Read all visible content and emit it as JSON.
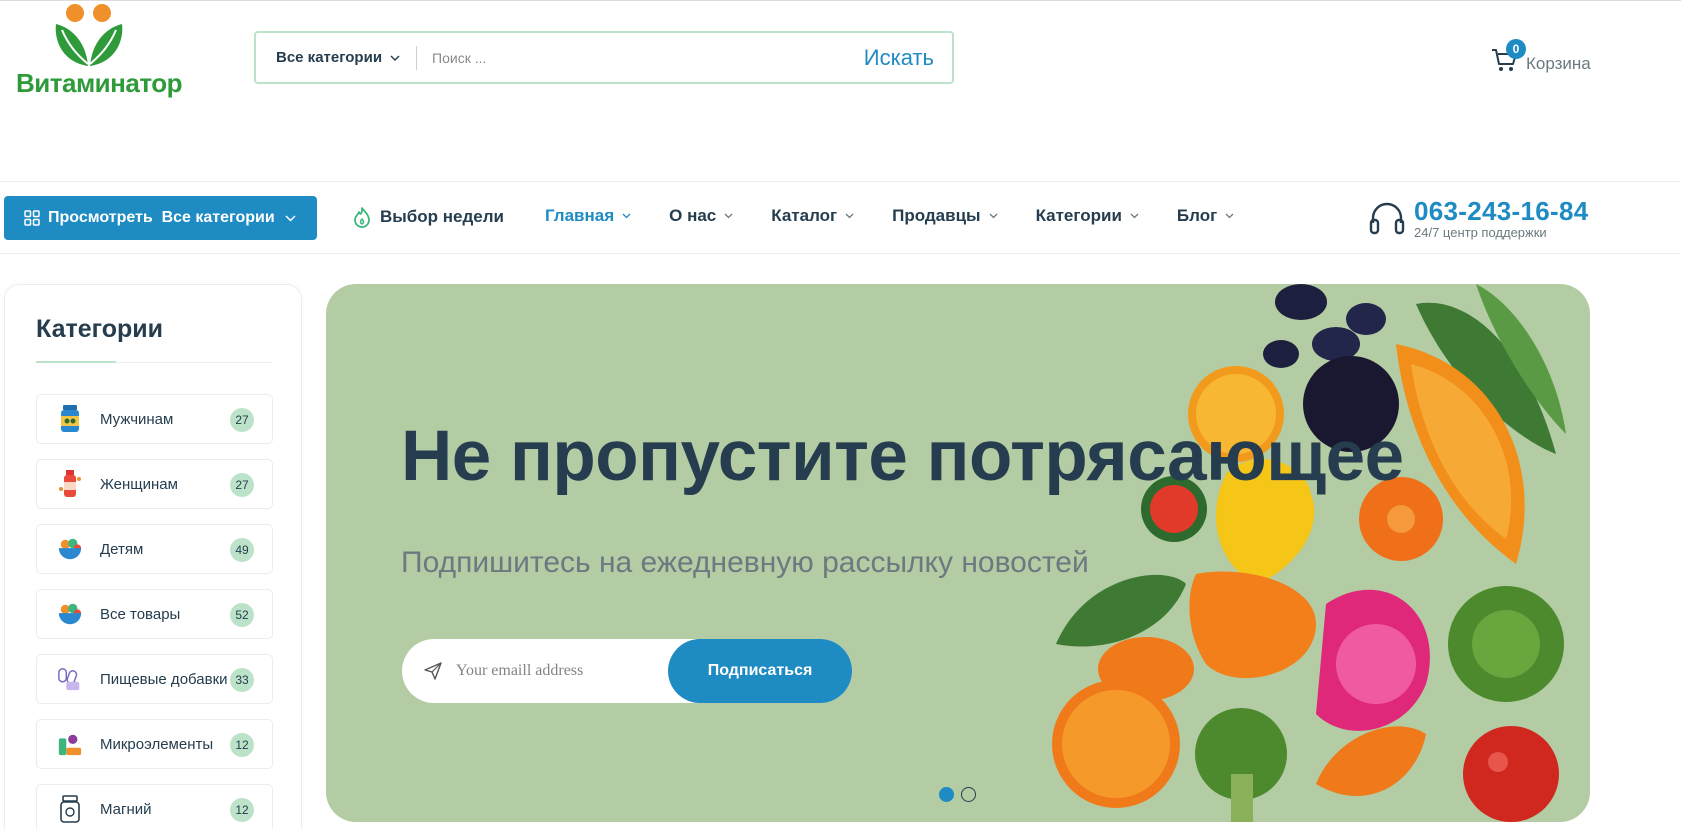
{
  "brand": {
    "name": "Витаминатор"
  },
  "search": {
    "category_label": "Все категории",
    "placeholder": "Поиск ...",
    "button_label": "Искать"
  },
  "cart": {
    "count": "0",
    "label": "Корзина"
  },
  "nav": {
    "browse_label": "Просмотреть  Все категории",
    "deal_label": "Выбор недели",
    "menu": [
      {
        "label": "Главная"
      },
      {
        "label": "О нас"
      },
      {
        "label": "Каталог"
      },
      {
        "label": "Продавцы"
      },
      {
        "label": "Категории"
      },
      {
        "label": "Блог"
      }
    ],
    "phone": "063-243-16-84",
    "phone_sub": "24/7 центр поддержки"
  },
  "sidebar": {
    "title": "Категории",
    "items": [
      {
        "name": "Мужчинам",
        "count": "27",
        "icon": "vitamin-jar-icon"
      },
      {
        "name": "Женщинам",
        "count": "27",
        "icon": "supplement-bottle-icon"
      },
      {
        "name": "Детям",
        "count": "49",
        "icon": "fruit-bowl-icon"
      },
      {
        "name": "Все товары",
        "count": "52",
        "icon": "fruit-bowl-icon"
      },
      {
        "name": "Пищевые добавки",
        "count": "33",
        "icon": "capsules-icon"
      },
      {
        "name": "Микроэлементы",
        "count": "12",
        "icon": "minerals-icon"
      },
      {
        "name": "Магний",
        "count": "12",
        "icon": "pill-jar-icon"
      }
    ]
  },
  "hero": {
    "title": "Не пропустите потрясающее",
    "subtitle": "Подпишитесь на ежедневную рассылку новостей",
    "email_placeholder": "Your emaill address",
    "subscribe_label": "Подписаться",
    "slides": 2,
    "active_slide": 1
  },
  "colors": {
    "primary": "#1e8bc3",
    "heading": "#253d4e",
    "muted": "#6b7a80",
    "accent_light": "#bce3c9",
    "brand_green": "#2e9a3a",
    "hero_bg": "#b3cca3"
  }
}
